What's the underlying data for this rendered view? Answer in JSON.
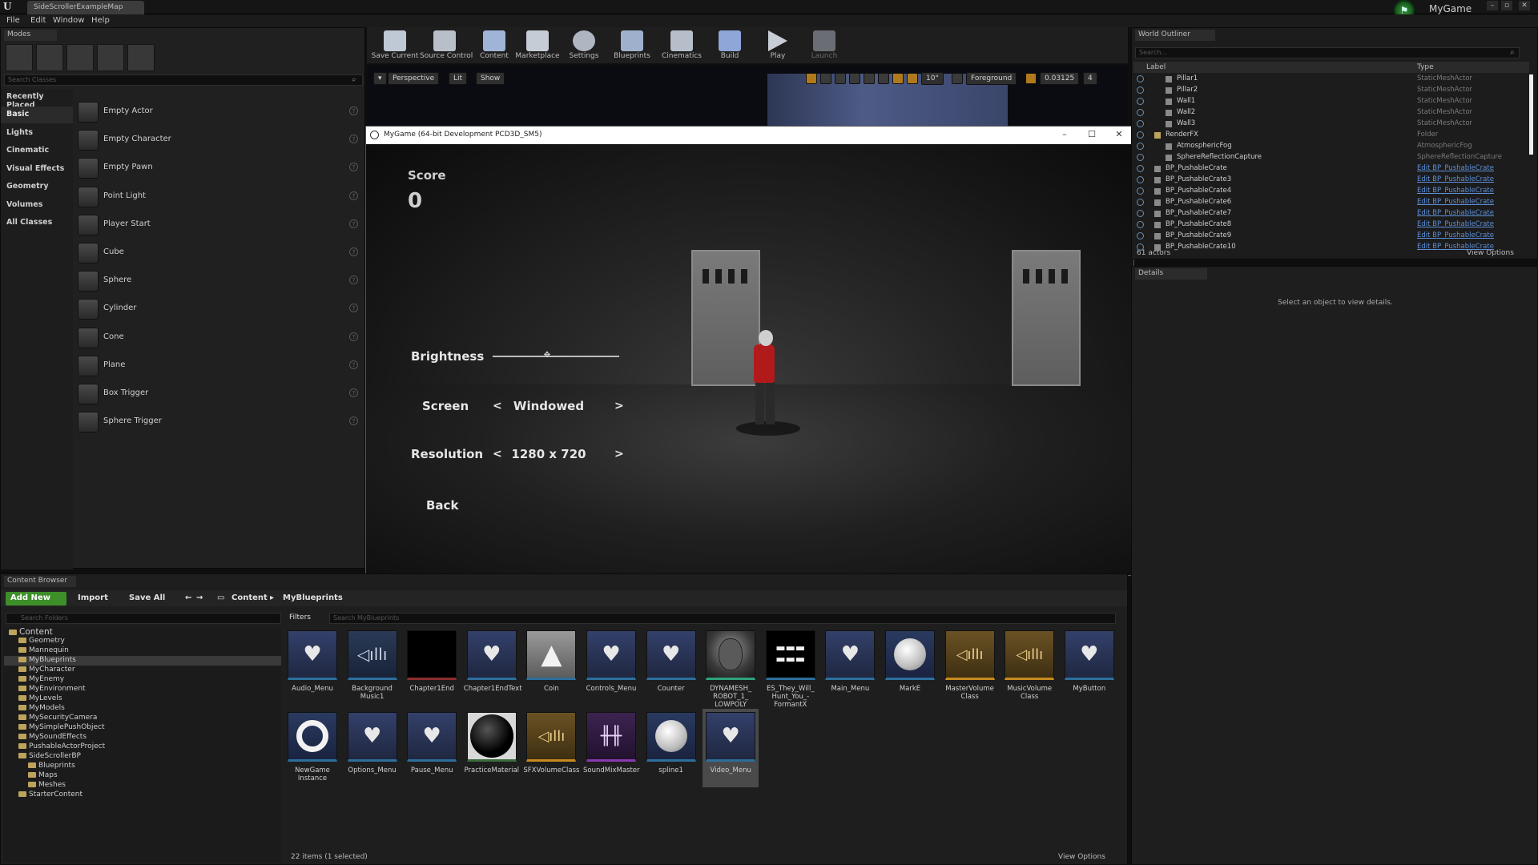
{
  "titlebar": {
    "map_tab": "SideScrollerExampleMap",
    "project": "MyGame",
    "controls": [
      "–",
      "▫",
      "✕"
    ]
  },
  "menu": [
    "File",
    "Edit",
    "Window",
    "Help"
  ],
  "modes": {
    "tab": "Modes",
    "search_placeholder": "Search Classes",
    "categories": [
      "Recently Placed",
      "Basic",
      "Lights",
      "Cinematic",
      "Visual Effects",
      "Geometry",
      "Volumes",
      "All Classes"
    ],
    "items": [
      "Empty Actor",
      "Empty Character",
      "Empty Pawn",
      "Point Light",
      "Player Start",
      "Cube",
      "Sphere",
      "Cylinder",
      "Cone",
      "Plane",
      "Box Trigger",
      "Sphere Trigger"
    ]
  },
  "toolbar": [
    "Save Current",
    "Source Control",
    "Content",
    "Marketplace",
    "Settings",
    "Blueprints",
    "Cinematics",
    "Build",
    "Play",
    "Launch"
  ],
  "viewport": {
    "perspective": "Perspective",
    "lit": "Lit",
    "show": "Show",
    "angle": "10°",
    "layer": "Foreground",
    "scale": "0.03125",
    "cams": "4"
  },
  "game": {
    "window_title": "MyGame (64-bit Development PCD3D_SM5)",
    "score_label": "Score",
    "score_value": "0",
    "brightness_label": "Brightness",
    "brightness_level": 0.43,
    "screen_label": "Screen",
    "screen_value": "Windowed",
    "resolution_label": "Resolution",
    "resolution_value": "1280 x 720",
    "prev": "<",
    "next": ">",
    "back": "Back"
  },
  "outliner": {
    "tab": "World Outliner",
    "search_placeholder": "Search...",
    "col_label": "Label",
    "col_type": "Type",
    "rows": [
      {
        "label": "Pillar1",
        "type": "StaticMeshActor"
      },
      {
        "label": "Pillar2",
        "type": "StaticMeshActor"
      },
      {
        "label": "Wall1",
        "type": "StaticMeshActor"
      },
      {
        "label": "Wall2",
        "type": "StaticMeshActor"
      },
      {
        "label": "Wall3",
        "type": "StaticMeshActor"
      },
      {
        "label": "RenderFX",
        "type": "Folder"
      },
      {
        "label": "AtmosphericFog",
        "type": "AtmosphericFog"
      },
      {
        "label": "SphereReflectionCapture",
        "type": "SphereReflectionCapture"
      },
      {
        "label": "BP_PushableCrate",
        "type": "Edit BP_PushableCrate"
      },
      {
        "label": "BP_PushableCrate3",
        "type": "Edit BP_PushableCrate"
      },
      {
        "label": "BP_PushableCrate4",
        "type": "Edit BP_PushableCrate"
      },
      {
        "label": "BP_PushableCrate6",
        "type": "Edit BP_PushableCrate"
      },
      {
        "label": "BP_PushableCrate7",
        "type": "Edit BP_PushableCrate"
      },
      {
        "label": "BP_PushableCrate8",
        "type": "Edit BP_PushableCrate"
      },
      {
        "label": "BP_PushableCrate9",
        "type": "Edit BP_PushableCrate"
      },
      {
        "label": "BP_PushableCrate10",
        "type": "Edit BP_PushableCrate"
      }
    ],
    "actor_count": "61 actors",
    "view_options": "View Options"
  },
  "details": {
    "tab": "Details",
    "message": "Select an object to view details."
  },
  "content_browser": {
    "tab": "Content Browser",
    "add_new": "Add New",
    "import": "Import",
    "save_all": "Save All",
    "path": [
      "Content",
      "MyBlueprints"
    ],
    "folder_search_placeholder": "Search Folders",
    "filters": "Filters",
    "asset_search_placeholder": "Search MyBlueprints",
    "folders": [
      {
        "name": "Content",
        "depth": 0
      },
      {
        "name": "Geometry",
        "depth": 1
      },
      {
        "name": "Mannequin",
        "depth": 1
      },
      {
        "name": "MyBlueprints",
        "depth": 1,
        "selected": true
      },
      {
        "name": "MyCharacter",
        "depth": 1
      },
      {
        "name": "MyEnemy",
        "depth": 1
      },
      {
        "name": "MyEnvironment",
        "depth": 1
      },
      {
        "name": "MyLevels",
        "depth": 1
      },
      {
        "name": "MyModels",
        "depth": 1
      },
      {
        "name": "MySecurityCamera",
        "depth": 1
      },
      {
        "name": "MySimplePushObject",
        "depth": 1
      },
      {
        "name": "MySoundEffects",
        "depth": 1
      },
      {
        "name": "PushableActorProject",
        "depth": 1
      },
      {
        "name": "SideScrollerBP",
        "depth": 1
      },
      {
        "name": "Blueprints",
        "depth": 2
      },
      {
        "name": "Maps",
        "depth": 2
      },
      {
        "name": "Meshes",
        "depth": 2
      },
      {
        "name": "StarterContent",
        "depth": 1
      }
    ],
    "assets": [
      {
        "name": "Audio_Menu",
        "kind": "widget"
      },
      {
        "name": "Background Music1",
        "kind": "sound"
      },
      {
        "name": "Chapter1End",
        "kind": "black"
      },
      {
        "name": "Chapter1EndText",
        "kind": "widget"
      },
      {
        "name": "Coin",
        "kind": "cone"
      },
      {
        "name": "Controls_Menu",
        "kind": "widget"
      },
      {
        "name": "Counter",
        "kind": "widget"
      },
      {
        "name": "DYNAMESH_ ROBOT_1_ LOWPOLY",
        "kind": "mesh"
      },
      {
        "name": "ES_They_Will_ Hunt_You_- FormantX",
        "kind": "wave"
      },
      {
        "name": "Main_Menu",
        "kind": "widget"
      },
      {
        "name": "MarkE",
        "kind": "sphere"
      },
      {
        "name": "MasterVolume Class",
        "kind": "soundclass"
      },
      {
        "name": "MusicVolume Class",
        "kind": "soundclass"
      },
      {
        "name": "MyButton",
        "kind": "widget"
      },
      {
        "name": "NewGame Instance",
        "kind": "ring"
      },
      {
        "name": "Options_Menu",
        "kind": "widget"
      },
      {
        "name": "Pause_Menu",
        "kind": "widget"
      },
      {
        "name": "PracticeMaterial",
        "kind": "material"
      },
      {
        "name": "SFXVolumeClass",
        "kind": "soundclass"
      },
      {
        "name": "SoundMixMaster",
        "kind": "mix"
      },
      {
        "name": "spline1",
        "kind": "sphere"
      },
      {
        "name": "Video_Menu",
        "kind": "widget",
        "selected": true
      }
    ],
    "footer": "22 items (1 selected)",
    "view_options": "View Options"
  },
  "colors": {
    "accent_green": "#3d8f2a",
    "link_blue": "#5d8fd8",
    "selection": "#4a4a4a",
    "character_red": "#b11a1a"
  }
}
